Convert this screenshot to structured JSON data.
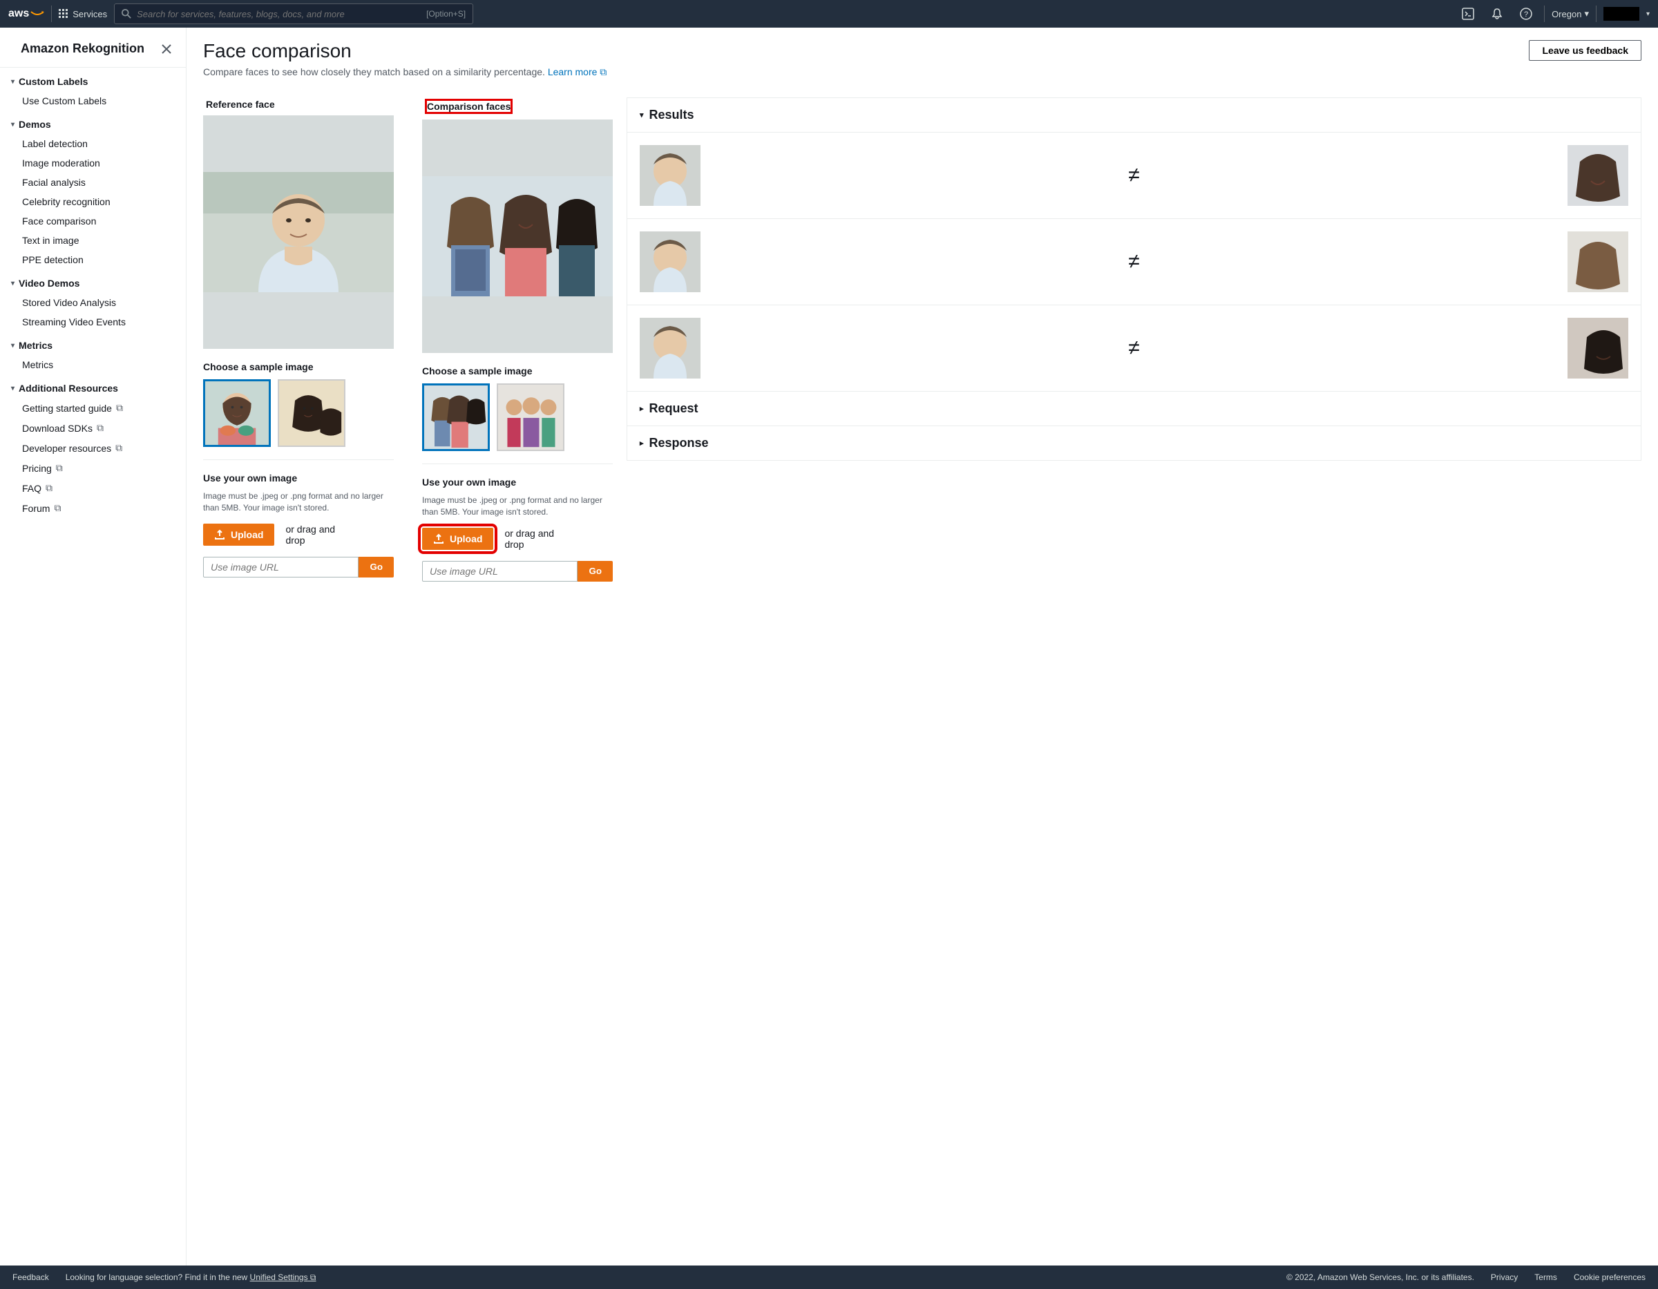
{
  "topnav": {
    "logo_text": "aws",
    "services_label": "Services",
    "search_placeholder": "Search for services, features, blogs, docs, and more",
    "shortcut": "[Option+S]",
    "region": "Oregon"
  },
  "sidebar": {
    "title": "Amazon Rekognition",
    "groups": [
      {
        "title": "Custom Labels",
        "items": [
          {
            "label": "Use Custom Labels"
          }
        ]
      },
      {
        "title": "Demos",
        "items": [
          {
            "label": "Label detection"
          },
          {
            "label": "Image moderation"
          },
          {
            "label": "Facial analysis"
          },
          {
            "label": "Celebrity recognition"
          },
          {
            "label": "Face comparison"
          },
          {
            "label": "Text in image"
          },
          {
            "label": "PPE detection"
          }
        ]
      },
      {
        "title": "Video Demos",
        "items": [
          {
            "label": "Stored Video Analysis"
          },
          {
            "label": "Streaming Video Events"
          }
        ]
      },
      {
        "title": "Metrics",
        "items": [
          {
            "label": "Metrics"
          }
        ]
      },
      {
        "title": "Additional Resources",
        "items": [
          {
            "label": "Getting started guide",
            "ext": true
          },
          {
            "label": "Download SDKs",
            "ext": true
          },
          {
            "label": "Developer resources",
            "ext": true
          },
          {
            "label": "Pricing",
            "ext": true
          },
          {
            "label": "FAQ",
            "ext": true
          },
          {
            "label": "Forum",
            "ext": true
          }
        ]
      }
    ]
  },
  "main": {
    "title": "Face comparison",
    "feedback_button": "Leave us feedback",
    "subtitle_text": "Compare faces to see how closely they match based on a similarity percentage. ",
    "learn_more": "Learn more",
    "reference_heading": "Reference face",
    "comparison_heading": "Comparison faces",
    "choose_sample": "Choose a sample image",
    "own_image_heading": "Use your own image",
    "own_image_hint": "Image must be .jpeg or .png format and no larger than 5MB. Your image isn't stored.",
    "upload_label": "Upload",
    "drag_text": "or drag and drop",
    "url_placeholder": "Use image URL",
    "go_label": "Go"
  },
  "results": {
    "title": "Results",
    "request_label": "Request",
    "response_label": "Response"
  },
  "footer": {
    "feedback": "Feedback",
    "lang_prompt": "Looking for language selection? Find it in the new ",
    "unified": "Unified Settings",
    "copyright": "© 2022, Amazon Web Services, Inc. or its affiliates.",
    "privacy": "Privacy",
    "terms": "Terms",
    "cookies": "Cookie preferences"
  }
}
